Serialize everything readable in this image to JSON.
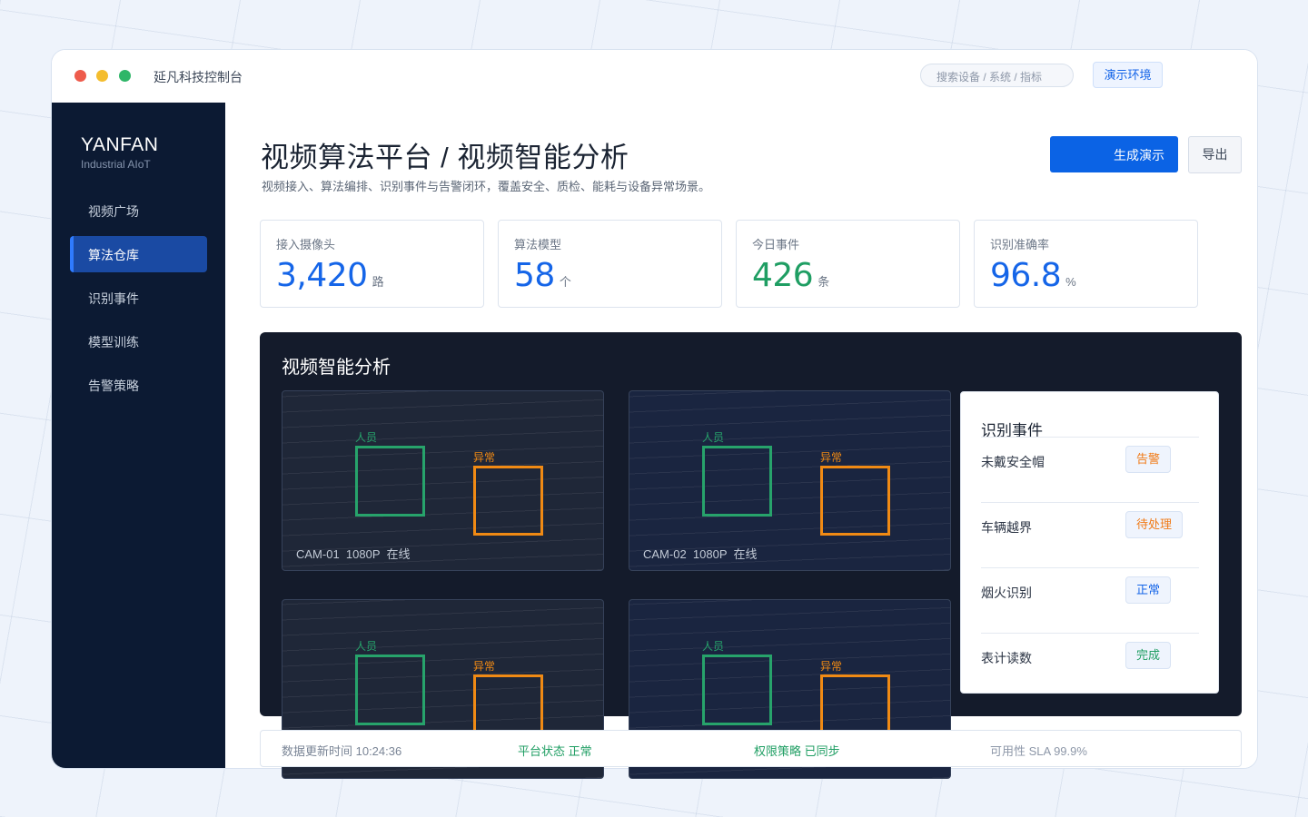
{
  "window": {
    "app_title": "延凡科技控制台",
    "search_placeholder": "搜索设备 / 系统 / 指标",
    "env_button": "演示环境"
  },
  "sidebar": {
    "brand": "YANFAN",
    "brand_sub": "Industrial AIoT",
    "items": [
      {
        "label": "视频广场"
      },
      {
        "label": "算法仓库"
      },
      {
        "label": "识别事件"
      },
      {
        "label": "模型训练"
      },
      {
        "label": "告警策略"
      }
    ]
  },
  "header": {
    "title": "视频算法平台 / 视频智能分析",
    "subtitle": "视频接入、算法编排、识别事件与告警闭环，覆盖安全、质检、能耗与设备异常场景。",
    "primary_button": "生成演示",
    "export_button": "导出"
  },
  "stats": [
    {
      "label": "接入摄像头",
      "value": "3,420",
      "unit": "路",
      "color": "#1565e8"
    },
    {
      "label": "算法模型",
      "value": "58",
      "unit": "个",
      "color": "#1565e8"
    },
    {
      "label": "今日事件",
      "value": "426",
      "unit": "条",
      "color": "#1f9e63"
    },
    {
      "label": "识别准确率",
      "value": "96.8",
      "unit": "%",
      "color": "#1565e8"
    }
  ],
  "analysis": {
    "title": "视频智能分析",
    "cameras": [
      {
        "caption": "CAM-01  1080P  在线",
        "person_label": "人员",
        "anomaly_label": "异常"
      },
      {
        "caption": "CAM-02  1080P  在线",
        "person_label": "人员",
        "anomaly_label": "异常"
      },
      {
        "caption": "",
        "person_label": "人员",
        "anomaly_label": "异常"
      },
      {
        "caption": "",
        "person_label": "人员",
        "anomaly_label": "异常"
      }
    ],
    "events_panel": {
      "title": "识别事件",
      "events": [
        {
          "name": "未戴安全帽",
          "status": "告警",
          "color": "#f07a16"
        },
        {
          "name": "车辆越界",
          "status": "待处理",
          "color": "#f07a16"
        },
        {
          "name": "烟火识别",
          "status": "正常",
          "color": "#1565e8"
        },
        {
          "name": "表计读数",
          "status": "完成",
          "color": "#1f9e63"
        }
      ]
    }
  },
  "footer": {
    "update_time": "数据更新时间 10:24:36",
    "platform_status": "平台状态 正常",
    "policy_status": "权限策略 已同步",
    "sla": "可用性 SLA 99.9%"
  },
  "colors": {
    "accent": "#0b63e5",
    "sidebar_bg": "#0c1a33",
    "panel_bg": "#141b2b",
    "person_box": "#27a36b",
    "anomaly_box": "#f08a14"
  }
}
